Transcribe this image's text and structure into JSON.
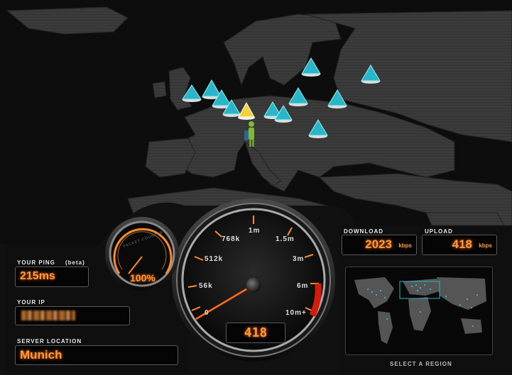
{
  "ping": {
    "label": "YOUR PING",
    "beta": "(beta)",
    "value": "215ms"
  },
  "ip": {
    "label": "YOUR IP",
    "value": "[redacted]"
  },
  "server": {
    "label": "SERVER LOCATION",
    "value": "Munich"
  },
  "packet_loss": {
    "dial_label": "PACKET COUNTER",
    "value": "100%",
    "level": 1.0
  },
  "speedometer": {
    "ticks": [
      "0",
      "56k",
      "512k",
      "768k",
      "1m",
      "1.5m",
      "3m",
      "6m",
      "10m+"
    ],
    "reading": "418",
    "needle_value_kbps": 418
  },
  "download": {
    "label": "DOWNLOAD",
    "value": "2023",
    "unit": "kbps"
  },
  "upload": {
    "label": "UPLOAD",
    "value": "418",
    "unit": "kbps"
  },
  "region": {
    "label": "SELECT A REGION"
  },
  "colors": {
    "accent": "#ff8a2a",
    "marker": "#2bb5c8",
    "selected_marker": "#f2d23a",
    "land": "#3d3d3d"
  },
  "map": {
    "servers": 14,
    "selected_server": "Munich"
  }
}
